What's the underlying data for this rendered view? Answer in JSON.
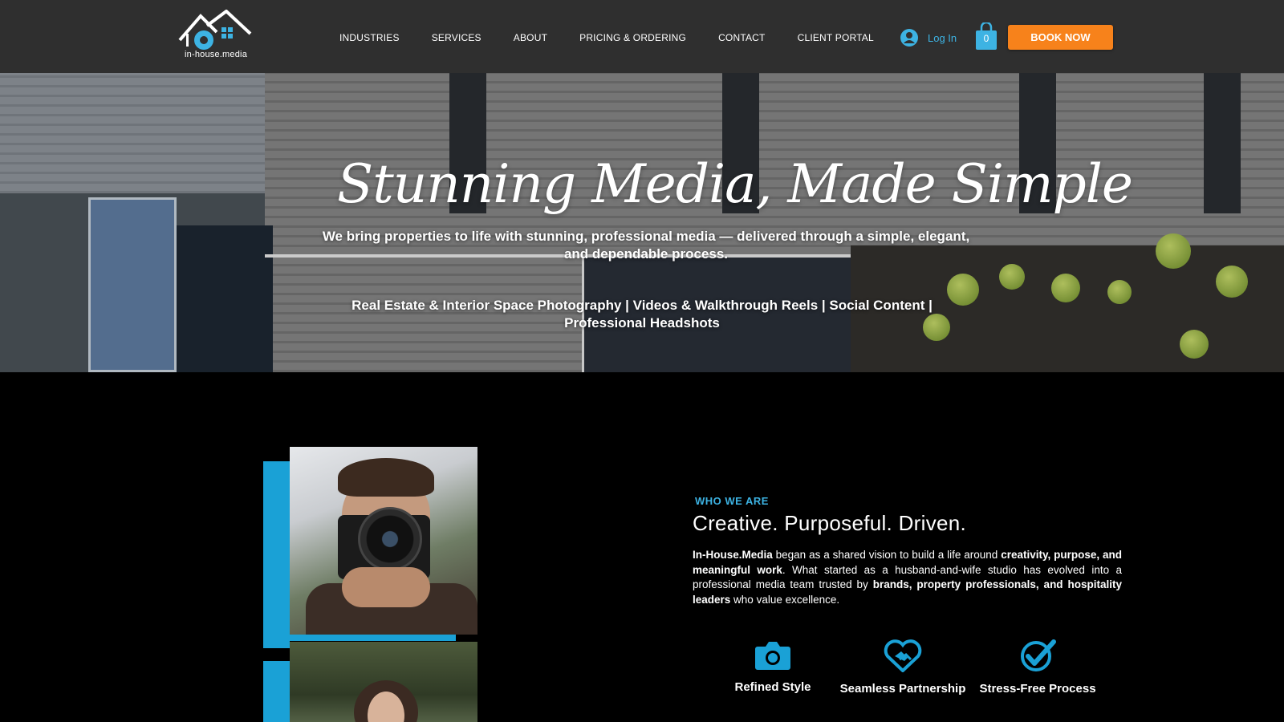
{
  "header": {
    "logo_text": "in-house.media",
    "nav": [
      "INDUSTRIES",
      "SERVICES",
      "ABOUT",
      "PRICING & ORDERING",
      "CONTACT",
      "CLIENT PORTAL"
    ],
    "login_label": "Log In",
    "cart_count": "0",
    "book_label": "BOOK NOW",
    "colors": {
      "header_bg": "#2f2f2f",
      "accent_blue": "#3db3e3",
      "book_orange": "#f7821b"
    }
  },
  "hero": {
    "script_title": "Stunning Media, Made Simple",
    "subtitle": "We bring properties to life with stunning, professional media — delivered through a simple, elegant, and dependable process.",
    "services": "Real Estate & Interior Space Photography | Videos & Walkthrough Reels | Social Content | Professional Headshots"
  },
  "about": {
    "eyebrow": "WHO WE ARE",
    "title": "Creative. Purposeful. Driven.",
    "body": {
      "p1_bold1": "In-House.Media",
      "p1_text1": " began as a shared vision to build a life around ",
      "p1_bold2": "creativity, purpose, and meaningful work",
      "p1_text2": ". What started as a husband-and-wife studio has evolved into a professional media team trusted by ",
      "p1_bold3": "brands, property professionals, and hospitality leaders",
      "p1_text3": " who value excellence."
    },
    "features": [
      {
        "icon": "camera-icon",
        "label": "Refined Style"
      },
      {
        "icon": "heart-handshake-icon",
        "label": "Seamless Partnership"
      },
      {
        "icon": "check-circle-icon",
        "label": "Stress-Free Process"
      }
    ],
    "colors": {
      "accent_blue": "#1aa1d6"
    }
  }
}
